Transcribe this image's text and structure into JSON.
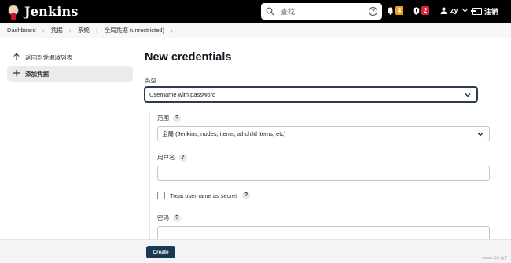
{
  "header": {
    "brand": "Jenkins",
    "search_placeholder": "查找",
    "search_help": "?",
    "notifications_count": "4",
    "security_count": "2",
    "user": "zy",
    "logout_label": "注销"
  },
  "breadcrumb": [
    "Dashboard",
    "凭据",
    "系统",
    "全局凭据 (unrestricted)"
  ],
  "sidebar": {
    "items": [
      {
        "label": "返回到凭据域列表",
        "icon": "arrow-up-icon"
      },
      {
        "label": "添加凭据",
        "icon": "plus-icon"
      }
    ]
  },
  "form": {
    "title": "New credentials",
    "kind_label": "类型",
    "kind_value": "Username with password",
    "scope_label": "范围",
    "scope_value": "全局 (Jenkins, nodes, items, all child items, etc)",
    "username_label": "用户名",
    "username_value": "",
    "treat_secret_label": "Treat username as secret",
    "password_label": "密码",
    "help": "?"
  },
  "footer": {
    "create_label": "Create",
    "watermark": "CSDN @小鱼干"
  },
  "colors": {
    "header_bg": "#000000",
    "badge_warning": "#f0a020",
    "badge_security": "#d9243a",
    "create_button": "#1a3a54"
  }
}
